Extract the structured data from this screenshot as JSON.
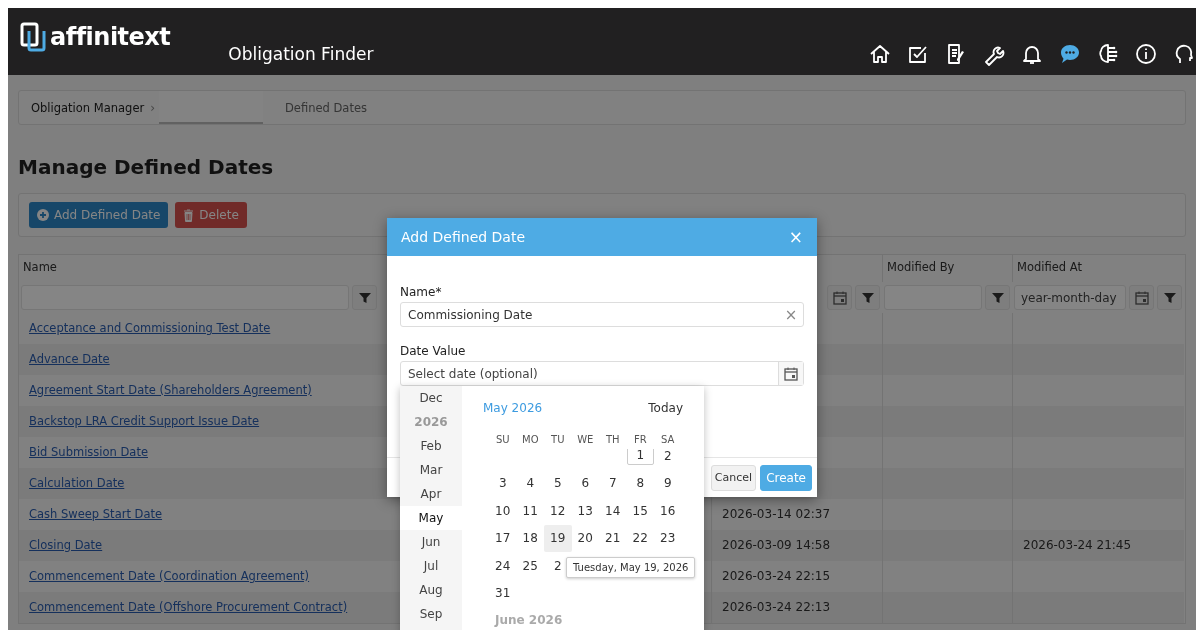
{
  "topbar": {
    "logo": "affinitext",
    "app_title": "Obligation Finder",
    "nav_icons": [
      {
        "active": false
      },
      {
        "active": false
      },
      {
        "active": false
      },
      {
        "active": false
      },
      {
        "active": false
      },
      {
        "active": true
      },
      {
        "active": false
      },
      {
        "active": false
      },
      {
        "active": false
      }
    ]
  },
  "breadcrumb": [
    {
      "kind": "link",
      "label": "Obligation Manager",
      "separator": "›"
    },
    {
      "kind": "blank"
    },
    {
      "kind": "current",
      "label": "Defined Dates"
    }
  ],
  "page_title": "Manage Defined Dates",
  "toolbar": [
    {
      "kind": "primary",
      "label": "Add Defined Date"
    },
    {
      "kind": "danger",
      "label": "Delete"
    }
  ],
  "table": {
    "columns": [
      {
        "label": "Name",
        "kind": "text"
      },
      {
        "kind": "date"
      },
      {
        "label": "Modified By",
        "kind": "text"
      },
      {
        "label": "Modified At",
        "kind": "date",
        "placeholder": "year-month-day"
      }
    ],
    "rows": [
      {
        "name": "Acceptance and Commissioning Test Date"
      },
      {
        "name": "Advance Date"
      },
      {
        "name": "Agreement Start Date (Shareholders Agreement)"
      },
      {
        "name": "Backstop LRA Credit Support Issue Date"
      },
      {
        "name": "Bid Submission Date"
      },
      {
        "name": "Calculation Date"
      },
      {
        "name": "Cash Sweep Start Date",
        "column_3": "2026-03-14 02:37"
      },
      {
        "name": "Closing Date",
        "column_3": "2026-03-09 14:58",
        "modified_at": "2026-03-24 21:45"
      },
      {
        "name": "Commencement Date (Coordination Agreement)",
        "column_3": "2026-03-24 22:15"
      },
      {
        "name": "Commencement Date (Offshore Procurement Contract)",
        "column_3": "2026-03-24 22:13"
      }
    ]
  },
  "dialog": {
    "title": "Add Defined Date",
    "close": "×",
    "fields": [
      {
        "kind": "text",
        "label": "Name*",
        "value": "Commissioning Date",
        "clear": "×"
      },
      {
        "kind": "date",
        "label": "Date Value",
        "placeholder": "Select date (optional)"
      }
    ],
    "buttons": [
      {
        "kind": "secondary",
        "label": "Cancel"
      },
      {
        "kind": "primary",
        "label": "Create"
      }
    ]
  },
  "date_picker": {
    "months": [
      {
        "kind": "month",
        "label": "Dec",
        "selected": false
      },
      {
        "kind": "year",
        "label": "2026",
        "selected": false
      },
      {
        "kind": "month",
        "label": "Feb",
        "selected": false
      },
      {
        "kind": "month",
        "label": "Mar",
        "selected": false
      },
      {
        "kind": "month",
        "label": "Apr",
        "selected": false
      },
      {
        "kind": "month",
        "label": "May",
        "selected": true
      },
      {
        "kind": "month",
        "label": "Jun",
        "selected": false
      },
      {
        "kind": "month",
        "label": "Jul",
        "selected": false
      },
      {
        "kind": "month",
        "label": "Aug",
        "selected": false
      },
      {
        "kind": "month",
        "label": "Sep",
        "selected": false
      }
    ],
    "title": "May 2026",
    "today_button": "Today",
    "weekdays": [
      "SU",
      "MO",
      "TU",
      "WE",
      "TH",
      "FR",
      "SA"
    ],
    "weeks": [
      {
        "kind": "leading",
        "days": [
          {
            "day": "1",
            "today": true,
            "hovered": false
          },
          {
            "day": "2",
            "today": false,
            "hovered": false
          }
        ]
      },
      {
        "kind": "full",
        "days": [
          {
            "day": "3",
            "today": false,
            "hovered": false
          },
          {
            "day": "4",
            "today": false,
            "hovered": false
          },
          {
            "day": "5",
            "today": false,
            "hovered": false
          },
          {
            "day": "6",
            "today": false,
            "hovered": false
          },
          {
            "day": "7",
            "today": false,
            "hovered": false
          },
          {
            "day": "8",
            "today": false,
            "hovered": false
          },
          {
            "day": "9",
            "today": false,
            "hovered": false
          }
        ]
      },
      {
        "kind": "full",
        "days": [
          {
            "day": "10",
            "today": false,
            "hovered": false
          },
          {
            "day": "11",
            "today": false,
            "hovered": false
          },
          {
            "day": "12",
            "today": false,
            "hovered": false
          },
          {
            "day": "13",
            "today": false,
            "hovered": false
          },
          {
            "day": "14",
            "today": false,
            "hovered": false
          },
          {
            "day": "15",
            "today": false,
            "hovered": false
          },
          {
            "day": "16",
            "today": false,
            "hovered": false
          }
        ]
      },
      {
        "kind": "full",
        "days": [
          {
            "day": "17",
            "today": false,
            "hovered": false
          },
          {
            "day": "18",
            "today": false,
            "hovered": false
          },
          {
            "day": "19",
            "today": false,
            "hovered": true
          },
          {
            "day": "20",
            "today": false,
            "hovered": false
          },
          {
            "day": "21",
            "today": false,
            "hovered": false
          },
          {
            "day": "22",
            "today": false,
            "hovered": false
          },
          {
            "day": "23",
            "today": false,
            "hovered": false
          }
        ]
      },
      {
        "kind": "full",
        "days": [
          {
            "day": "24",
            "today": false,
            "hovered": false
          },
          {
            "day": "25",
            "today": false,
            "hovered": false
          },
          {
            "day": "2",
            "today": false,
            "hovered": false
          }
        ]
      },
      {
        "kind": "trailing",
        "days": [
          {
            "day": "31",
            "today": false,
            "hovered": false
          }
        ]
      }
    ],
    "next_month": "June 2026",
    "tooltip": "Tuesday, May 19, 2026"
  }
}
